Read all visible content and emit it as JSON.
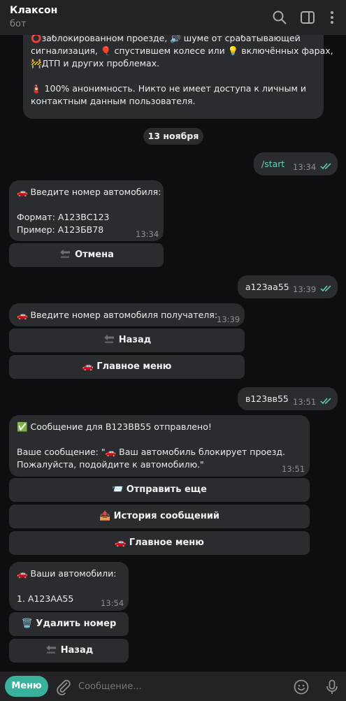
{
  "header": {
    "title": "Клаксон",
    "subtitle": "бот",
    "icons": [
      "search-icon",
      "sidebar-icon",
      "more-icon"
    ]
  },
  "intro": {
    "line1": "⭕заблокированном проезде, 🔊 шуме от срабатывающей",
    "line2": "сигнализация, 🎈 спустившем колесе или 💡 включённых фарах,",
    "line3": "🚧ДТП и других проблемах.",
    "line4": "🧯 100% анонимность. Никто не имеет доступа к личным и",
    "line5": "контактным данным пользователя."
  },
  "date_label": "13 ноября",
  "messages": {
    "m1": {
      "text": "/start",
      "time": "13:34"
    },
    "m2": {
      "line1": "🚗 Введите номер автомобиля:",
      "line2": "Формат: А123ВС123",
      "line3": "Пример: А123БВ78",
      "time": "13:34",
      "button": "Отмена"
    },
    "m3": {
      "text": "а123аа55",
      "time": "13:39"
    },
    "m4": {
      "line1": "🚗 Введите номер автомобиля получателя:",
      "time": "13:39",
      "button1": "Назад",
      "button2": "🚗 Главное меню"
    },
    "m5": {
      "text": "в123вв55",
      "time": "13:51"
    },
    "m6": {
      "line1": "✅ Сообщение для В123ВВ55 отправлено!",
      "line2": "Ваше сообщение: \"🚗 Ваш автомобиль блокирует проезд.",
      "line3": "Пожалуйста, подойдите к автомобилю.\"",
      "time": "13:51",
      "button1": "📨 Отправить еще",
      "button2": "📤 История сообщений",
      "button3": "🚗 Главное меню"
    },
    "m7": {
      "line1": "🚗 Ваши автомобили:",
      "line2": "1. А123АА55",
      "time": "13:54",
      "button1": "🗑️ Удалить номер",
      "button2": "Назад"
    }
  },
  "composer": {
    "menu_label": "Меню",
    "placeholder": "Сообщение...",
    "icons": [
      "attach-icon",
      "emoji-icon",
      "mic-icon"
    ]
  },
  "colors": {
    "background": "#0e0e10",
    "bubble": "#2b2c30",
    "accent": "#38b29c",
    "read_checks": "#5fd4bd"
  }
}
